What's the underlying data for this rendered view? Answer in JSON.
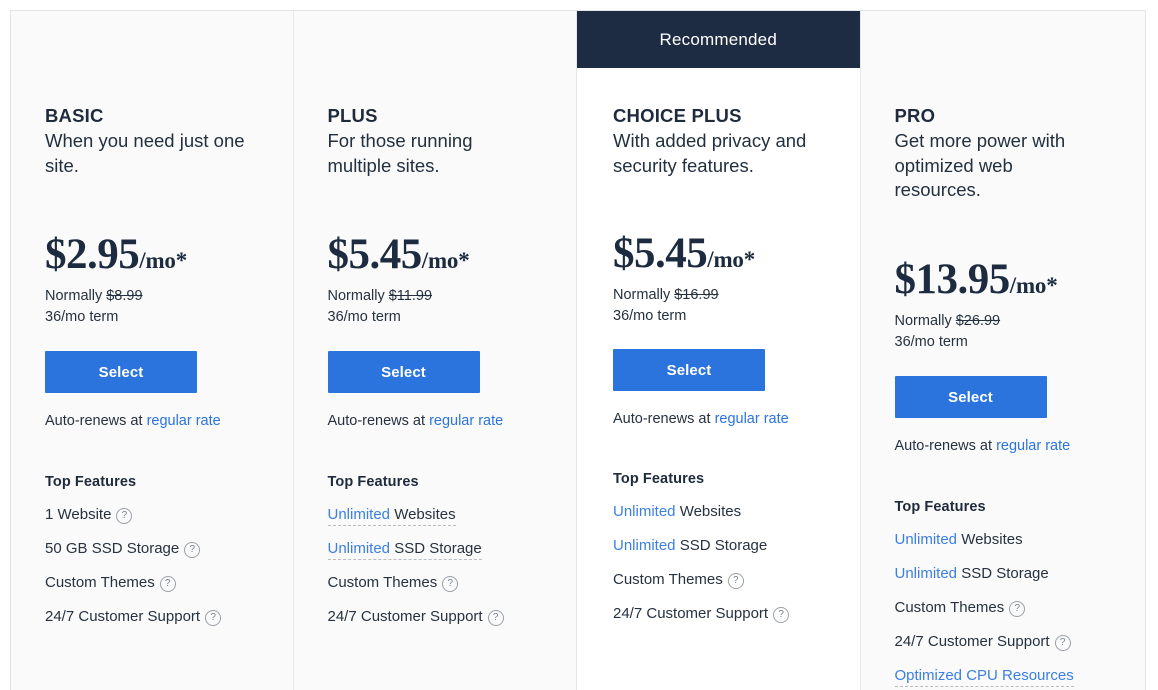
{
  "card": {
    "recommended_label": "Recommended",
    "select_label": "Select",
    "features_heading": "Top Features",
    "autorenew_prefix": "Auto-renews at ",
    "autorenew_link": "regular rate",
    "term_label": "36/mo term",
    "normally_prefix": "Normally ",
    "price_suffix": "/mo*",
    "tooltip_icon": "question-circle-icon",
    "colors": {
      "accent_blue": "#2b74dd",
      "link_blue": "#3b7fe0",
      "banner_navy": "#1d2c42",
      "text_dark": "#26323f",
      "bg_default": "#fafafa",
      "bg_featured": "#ffffff",
      "border": "#e6e7e9"
    }
  },
  "plans": [
    {
      "id": "basic",
      "name": "BASIC",
      "description": "When you need just one site.",
      "price": "$2.95",
      "normally_price": "$8.99",
      "featured": false,
      "features": [
        {
          "blue": "",
          "text": "1 Website",
          "tooltip": true,
          "dashed": false
        },
        {
          "blue": "",
          "text": "50 GB SSD Storage",
          "tooltip": true,
          "dashed": false
        },
        {
          "blue": "",
          "text": "Custom Themes",
          "tooltip": true,
          "dashed": false
        },
        {
          "blue": "",
          "text": "24/7 Customer Support",
          "tooltip": true,
          "dashed": false
        }
      ]
    },
    {
      "id": "plus",
      "name": "PLUS",
      "description": "For those running multiple sites.",
      "price": "$5.45",
      "normally_price": "$11.99",
      "featured": false,
      "features": [
        {
          "blue": "Unlimited",
          "text": " Websites",
          "tooltip": false,
          "dashed": true
        },
        {
          "blue": "Unlimited",
          "text": " SSD Storage",
          "tooltip": false,
          "dashed": true
        },
        {
          "blue": "",
          "text": "Custom Themes",
          "tooltip": true,
          "dashed": false
        },
        {
          "blue": "",
          "text": "24/7 Customer Support",
          "tooltip": true,
          "dashed": false
        }
      ]
    },
    {
      "id": "choice-plus",
      "name": "CHOICE PLUS",
      "description": "With added privacy and security features.",
      "price": "$5.45",
      "normally_price": "$16.99",
      "featured": true,
      "features": [
        {
          "blue": "Unlimited",
          "text": " Websites",
          "tooltip": false,
          "dashed": false
        },
        {
          "blue": "Unlimited",
          "text": " SSD Storage",
          "tooltip": false,
          "dashed": false
        },
        {
          "blue": "",
          "text": "Custom Themes",
          "tooltip": true,
          "dashed": false
        },
        {
          "blue": "",
          "text": "24/7 Customer Support",
          "tooltip": true,
          "dashed": false
        }
      ]
    },
    {
      "id": "pro",
      "name": "PRO",
      "description": "Get more power with optimized web resources.",
      "price": "$13.95",
      "normally_price": "$26.99",
      "featured": false,
      "features": [
        {
          "blue": "Unlimited",
          "text": " Websites",
          "tooltip": false,
          "dashed": false
        },
        {
          "blue": "Unlimited",
          "text": " SSD Storage",
          "tooltip": false,
          "dashed": false
        },
        {
          "blue": "",
          "text": "Custom Themes",
          "tooltip": true,
          "dashed": false
        },
        {
          "blue": "",
          "text": "24/7 Customer Support",
          "tooltip": true,
          "dashed": false
        },
        {
          "blue": "Optimized CPU Resources",
          "text": "",
          "tooltip": false,
          "dashed": true,
          "all_blue": true
        }
      ]
    }
  ]
}
